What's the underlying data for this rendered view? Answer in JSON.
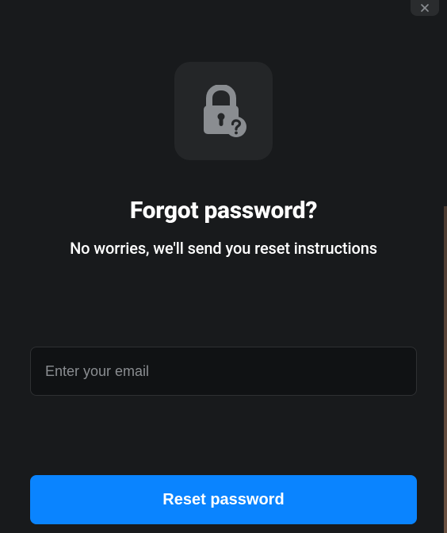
{
  "header": {
    "title": "Forgot password?",
    "subtitle": "No worries, we'll send you reset instructions"
  },
  "form": {
    "email_placeholder": "Enter your email",
    "reset_button_label": "Reset password"
  }
}
